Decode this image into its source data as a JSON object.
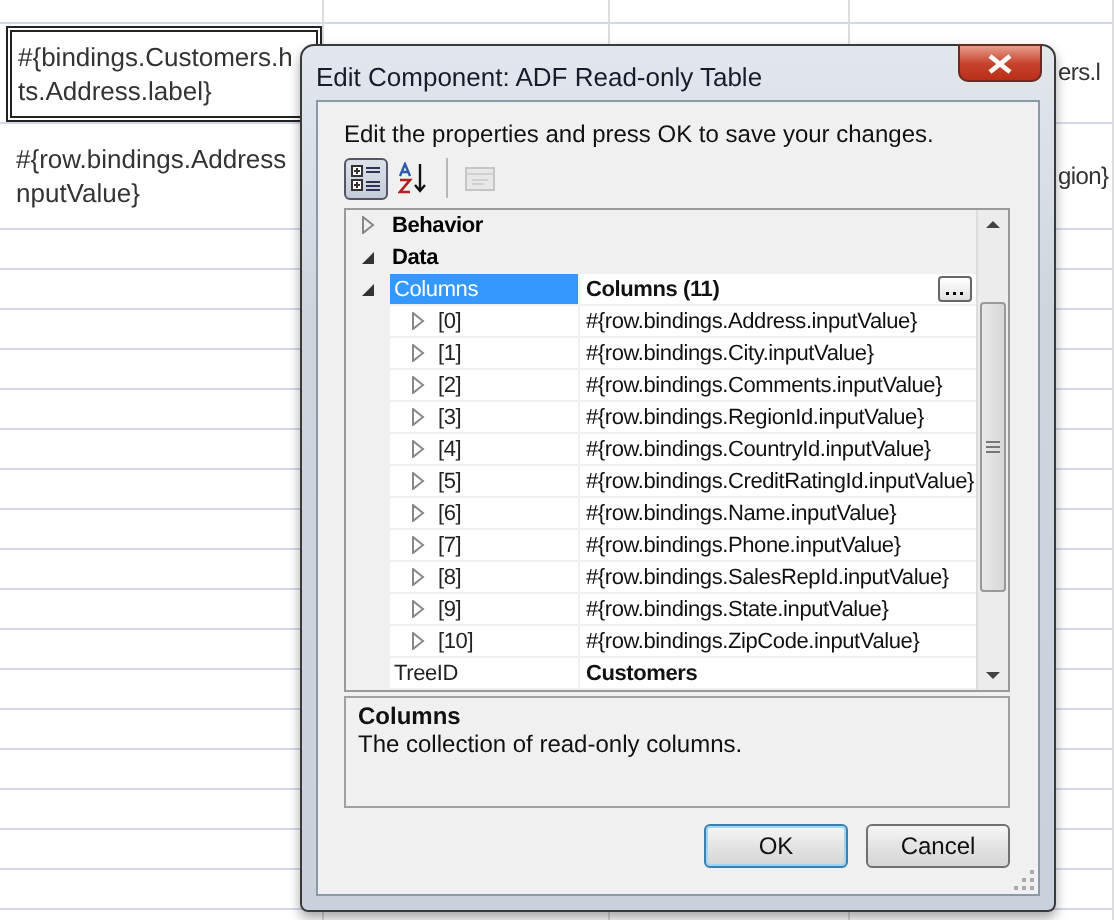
{
  "canvas": {
    "rows": [
      {
        "col_1": {
          "lines": [
            "#{bindings.Customers.h",
            "ts.Address.label}"
          ],
          "selected": true
        },
        "col_4": {
          "lines": [
            "ers.l"
          ],
          "selected": false
        }
      },
      {
        "col_1": {
          "lines": [
            "#{row.bindings.Address",
            "nputValue}"
          ],
          "selected": false
        },
        "col_4": {
          "lines": [
            "gion}"
          ],
          "selected": false
        }
      }
    ]
  },
  "dialog": {
    "title": "Edit Component: ADF Read-only Table",
    "instruction": "Edit the properties and press OK to save your changes.",
    "toolbar": [
      {
        "kind": "categorized",
        "selected": true,
        "disabled": false
      },
      {
        "kind": "alphabetical",
        "selected": false,
        "disabled": false
      },
      {
        "kind": "pages",
        "selected": false,
        "disabled": true
      }
    ],
    "categories": [
      {
        "name": "Behavior",
        "expanded": false
      },
      {
        "name": "Data",
        "expanded": true,
        "properties": [
          {
            "name": "Columns",
            "value": "Columns (11)",
            "modified": true,
            "selected": true,
            "expanded": true,
            "has_editor": true,
            "children": [
              {
                "name": "[0]",
                "value": "#{row.bindings.Address.inputValue}",
                "expanded": false
              },
              {
                "name": "[1]",
                "value": "#{row.bindings.City.inputValue}",
                "expanded": false
              },
              {
                "name": "[2]",
                "value": "#{row.bindings.Comments.inputValue}",
                "expanded": false
              },
              {
                "name": "[3]",
                "value": "#{row.bindings.RegionId.inputValue}",
                "expanded": false
              },
              {
                "name": "[4]",
                "value": "#{row.bindings.CountryId.inputValue}",
                "expanded": false
              },
              {
                "name": "[5]",
                "value": "#{row.bindings.CreditRatingId.inputValue}",
                "expanded": false
              },
              {
                "name": "[6]",
                "value": "#{row.bindings.Name.inputValue}",
                "expanded": false
              },
              {
                "name": "[7]",
                "value": "#{row.bindings.Phone.inputValue}",
                "expanded": false
              },
              {
                "name": "[8]",
                "value": "#{row.bindings.SalesRepId.inputValue}",
                "expanded": false
              },
              {
                "name": "[9]",
                "value": "#{row.bindings.State.inputValue}",
                "expanded": false
              },
              {
                "name": "[10]",
                "value": "#{row.bindings.ZipCode.inputValue}",
                "expanded": false
              }
            ]
          },
          {
            "name": "TreeID",
            "value": "Customers",
            "modified": true,
            "selected": false
          }
        ]
      }
    ],
    "description": {
      "title": "Columns",
      "text": "The collection of read-only columns."
    },
    "buttons": [
      {
        "label": "OK",
        "default": true
      },
      {
        "label": "Cancel",
        "default": false
      }
    ]
  }
}
